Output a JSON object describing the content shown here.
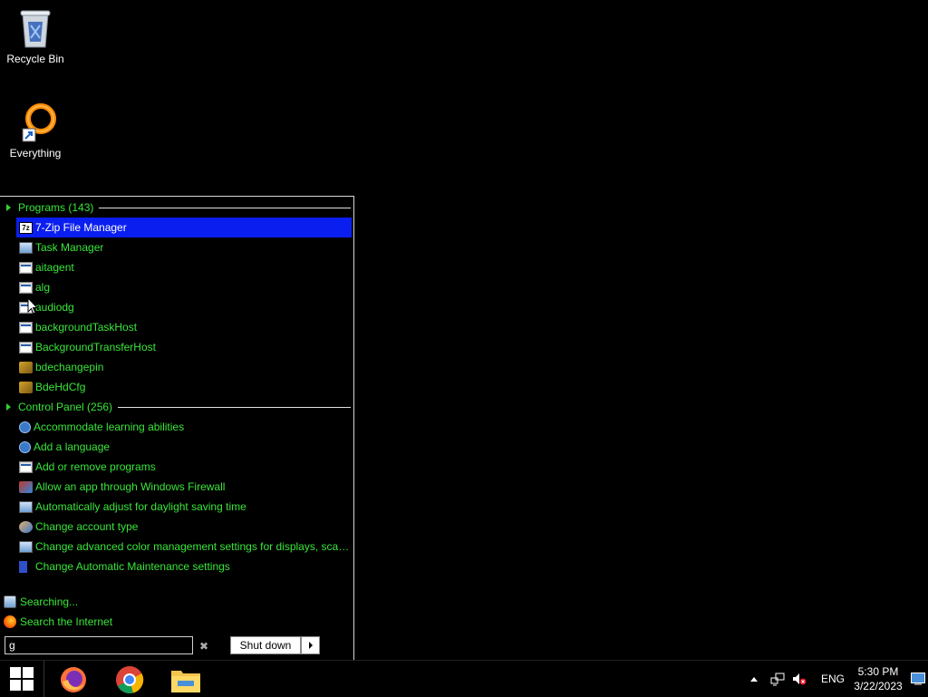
{
  "desktop": {
    "icons": [
      {
        "label": "Recycle Bin",
        "icon": "recycle-bin-icon"
      },
      {
        "label": "Everything",
        "icon": "everything-icon"
      }
    ]
  },
  "start_menu": {
    "programs": {
      "header": "Programs (143)",
      "items": [
        {
          "label": "7-Zip File Manager",
          "icon": "7zip-icon",
          "selected": true
        },
        {
          "label": "Task Manager",
          "icon": "task-manager-icon"
        },
        {
          "label": "aitagent",
          "icon": "window-icon"
        },
        {
          "label": "alg",
          "icon": "window-icon"
        },
        {
          "label": "audiodg",
          "icon": "window-icon"
        },
        {
          "label": "backgroundTaskHost",
          "icon": "window-icon"
        },
        {
          "label": "BackgroundTransferHost",
          "icon": "window-icon"
        },
        {
          "label": "bdechangepin",
          "icon": "keys-icon"
        },
        {
          "label": "BdeHdCfg",
          "icon": "keys-icon"
        }
      ]
    },
    "control_panel": {
      "header": "Control Panel (256)",
      "items": [
        {
          "label": "Accommodate learning abilities",
          "icon": "ease-of-access-icon"
        },
        {
          "label": "Add a language",
          "icon": "language-icon"
        },
        {
          "label": "Add or remove programs",
          "icon": "programs-icon"
        },
        {
          "label": "Allow an app through Windows Firewall",
          "icon": "firewall-icon"
        },
        {
          "label": "Automatically adjust for daylight saving time",
          "icon": "clock-icon"
        },
        {
          "label": "Change account type",
          "icon": "users-icon"
        },
        {
          "label": "Change advanced color management settings for displays, scan...",
          "icon": "monitor-icon"
        },
        {
          "label": "Change Automatic Maintenance settings",
          "icon": "flag-icon"
        }
      ]
    },
    "searching_label": "Searching...",
    "search_internet_label": "Search the Internet",
    "search_value": "g",
    "shutdown_label": "Shut down"
  },
  "taskbar": {
    "apps": [
      "firefox-icon",
      "chrome-icon",
      "file-explorer-icon"
    ],
    "language": "ENG",
    "time": "5:30 PM",
    "date": "3/22/2023"
  },
  "colors": {
    "accent_text": "#39e639",
    "selection": "#0a1ef0"
  }
}
